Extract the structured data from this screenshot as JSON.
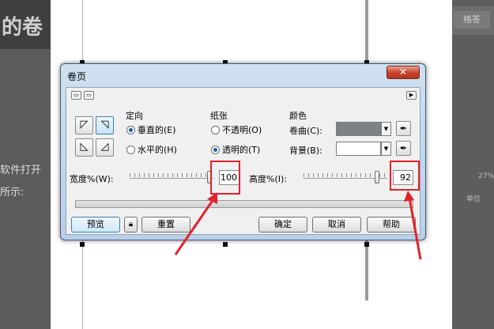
{
  "background": {
    "left_title": "的卷",
    "left_text1": "软件打开",
    "left_text2": "所示:",
    "right_button": "格答",
    "right_percent": "27%",
    "right_unit": "单位"
  },
  "dialog": {
    "title": "卷页",
    "close_glyph": "✕",
    "orientation": {
      "label": "定向",
      "options": [
        {
          "label": "垂直的(E)",
          "checked": true
        },
        {
          "label": "水平的(H)",
          "checked": false
        }
      ]
    },
    "paper": {
      "label": "纸张",
      "options": [
        {
          "label": "不透明(O)",
          "checked": false
        },
        {
          "label": "透明的(T)",
          "checked": true
        }
      ]
    },
    "colors": {
      "label": "颜色",
      "curl_label": "卷曲(C):",
      "curl_color": "#7f8285",
      "background_label": "背景(B):",
      "background_color": "#ffffff"
    },
    "width": {
      "label": "宽度%(W):",
      "value": "100",
      "slider_fraction": 0.98
    },
    "height": {
      "label": "高度%(I):",
      "value": "92",
      "slider_fraction": 0.9
    },
    "buttons": {
      "preview": "预览",
      "reset": "重置",
      "ok": "确定",
      "cancel": "取消",
      "help": "帮助"
    },
    "accent_color": "#3c7fb1"
  },
  "annotation_color": "#e3212b"
}
